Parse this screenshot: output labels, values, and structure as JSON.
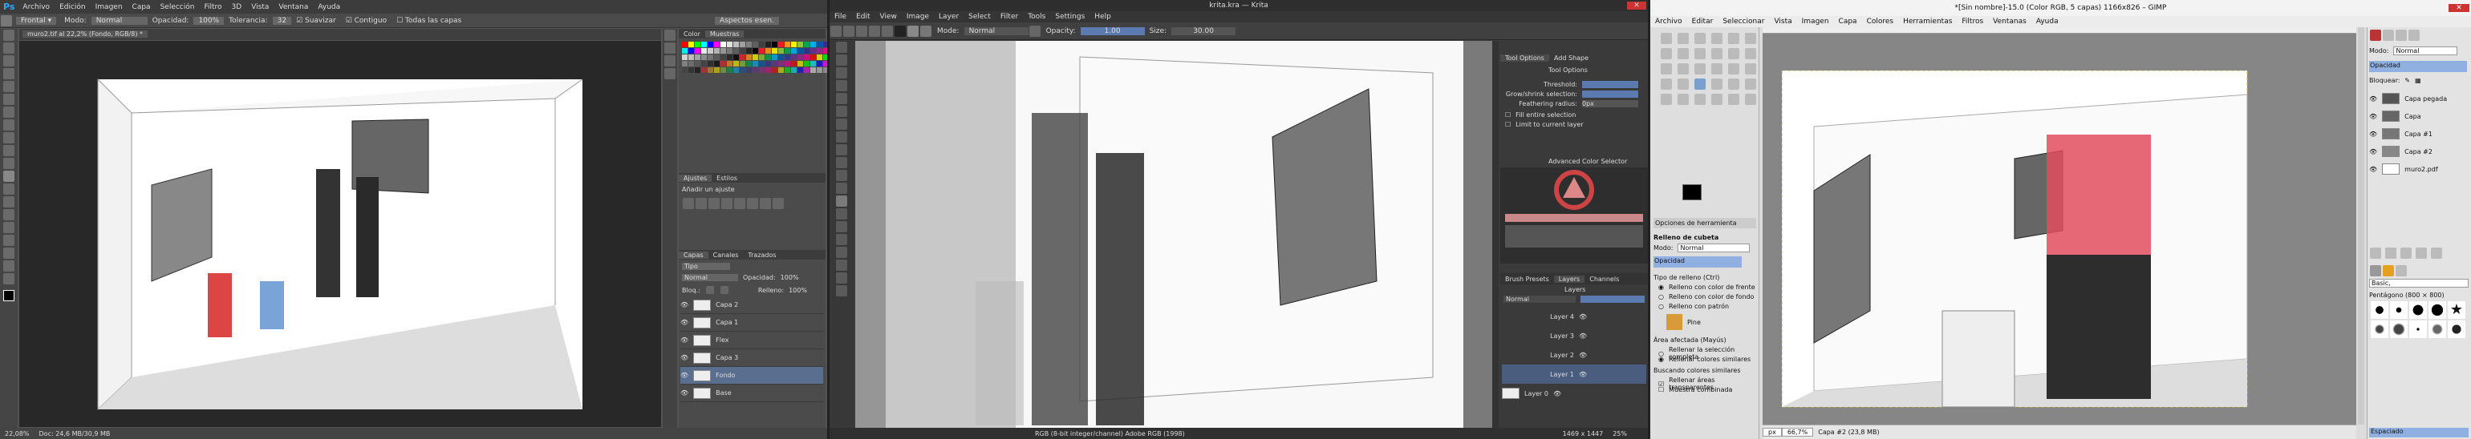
{
  "photoshop": {
    "logo": "Ps",
    "menu": [
      "Archivo",
      "Edición",
      "Imagen",
      "Capa",
      "Selección",
      "Filtro",
      "3D",
      "Vista",
      "Ventana",
      "Ayuda"
    ],
    "options": {
      "mode_label": "Modo:",
      "mode_value": "Normal",
      "opacity_label": "Opacidad:",
      "opacity_value": "100%",
      "tolerance_label": "Tolerancia:",
      "tolerance_value": "32",
      "suavizar": "Suavizar",
      "contiguo": "Contiguo",
      "todas": "Todas las capas",
      "workspace": "Aspectos esen."
    },
    "doc_tab": "muro2.tif al 22,2% (Fondo, RGB/8) *",
    "status": {
      "zoom": "22,08%",
      "doc": "Doc: 24,6 MB/30,9 MB"
    },
    "panel_tabs_color": [
      "Color",
      "Muestras"
    ],
    "panel_tabs_adjust": [
      "Ajustes",
      "Estilos"
    ],
    "adjust_label": "Añadir un ajuste",
    "panel_tabs_layers": [
      "Capas",
      "Canales",
      "Trazados"
    ],
    "layer_filter": "Tipo",
    "layer_mode": "Normal",
    "layer_opacity_label": "Opacidad:",
    "layer_opacity_value": "100%",
    "lock_label": "Bloq.:",
    "fill_label": "Relleno:",
    "fill_value": "100%",
    "layers": [
      "Capa 2",
      "Capa 1",
      "Flex",
      "Capa 3",
      "Fondo",
      "Base"
    ],
    "swatch_colors": [
      "#ff0000",
      "#ffff00",
      "#00ff00",
      "#00ffff",
      "#0000ff",
      "#ff00ff",
      "#ffffff",
      "#e0e0e0",
      "#c0c0c0",
      "#a0a0a0",
      "#808080",
      "#606060",
      "#404040",
      "#202020",
      "#000000",
      "#ed1c24",
      "#f7941d",
      "#fff200",
      "#8dc63f",
      "#00a651",
      "#00aeef",
      "#0054a6",
      "#2e3192",
      "#662d91",
      "#92278f",
      "#ec008c"
    ]
  },
  "krita": {
    "title": "krita.kra — Krita",
    "menu": [
      "File",
      "Edit",
      "View",
      "Image",
      "Layer",
      "Select",
      "Filter",
      "Tools",
      "Settings",
      "Help"
    ],
    "options": {
      "mode_label": "Mode:",
      "mode_value": "Normal",
      "opacity_label": "Opacity:",
      "opacity_value": "1.00",
      "size_label": "Size:",
      "size_value": "30.00"
    },
    "tab_tool_options": "Tool Options",
    "tab_add_shape": "Add Shape",
    "tool_options_title": "Tool Options",
    "fields": [
      {
        "label": "Threshold:",
        "value": ""
      },
      {
        "label": "Grow/shrink selection:",
        "value": ""
      },
      {
        "label": "Feathering radius:",
        "value": "0px"
      }
    ],
    "fill_entire": "Fill entire selection",
    "limit_layer": "Limit to current layer",
    "advanced_color": "Advanced Color Selector",
    "tabs_bottom": [
      "Brush Presets",
      "Layers",
      "Channels"
    ],
    "layers_title": "Layers",
    "blend_mode": "Normal",
    "layers": [
      "Layer 4",
      "Layer 3",
      "Layer 2",
      "Layer 1",
      "Layer 0"
    ],
    "status": {
      "color": "RGB (8-bit integer/channel)  Adobe RGB (1998)",
      "size": "1469 x 1447",
      "zoom": "25%"
    }
  },
  "gimp": {
    "title": "*[Sin nombre]-15.0 (Color RGB, 5 capas) 1166x826 – GIMP",
    "menu": [
      "Archivo",
      "Editar",
      "Seleccionar",
      "Vista",
      "Imagen",
      "Capa",
      "Colores",
      "Herramientas",
      "Filtros",
      "Ventanas",
      "Ayuda"
    ],
    "tool_options_tabs": "Opciones de herramienta",
    "bucket_title": "Relleno de cubeta",
    "mode_label": "Modo:",
    "mode_value": "Normal",
    "opacity_label": "Opacidad",
    "fill_type_label": "Tipo de relleno (Ctrl)",
    "fill_types": [
      "Relleno con color de frente",
      "Relleno con color de fondo",
      "Relleno con patrón"
    ],
    "pattern_name": "Pine",
    "affected_label": "Área afectada (Mayús)",
    "affected": [
      "Rellenar la selección completa",
      "Rellenar colores similares"
    ],
    "similar_label": "Buscando colores similares",
    "checks": [
      "Rellenar áreas transparentes",
      "Muestra combinada"
    ],
    "right_mode_label": "Modo:",
    "right_mode_value": "Normal",
    "right_opacity": "Opacidad",
    "right_lock": "Bloquear:",
    "layers": [
      "Capa pegada",
      "Capa",
      "Capa #1",
      "Capa #2",
      "muro2.pdf"
    ],
    "brush_filter": "Basic,",
    "brush_size": "Pentágono (800 × 800)",
    "brush_spacing": "Espaciado",
    "status": {
      "unit": "px",
      "zoom": "66,7%",
      "layer": "Capa #2 (23,8 MB)"
    }
  }
}
